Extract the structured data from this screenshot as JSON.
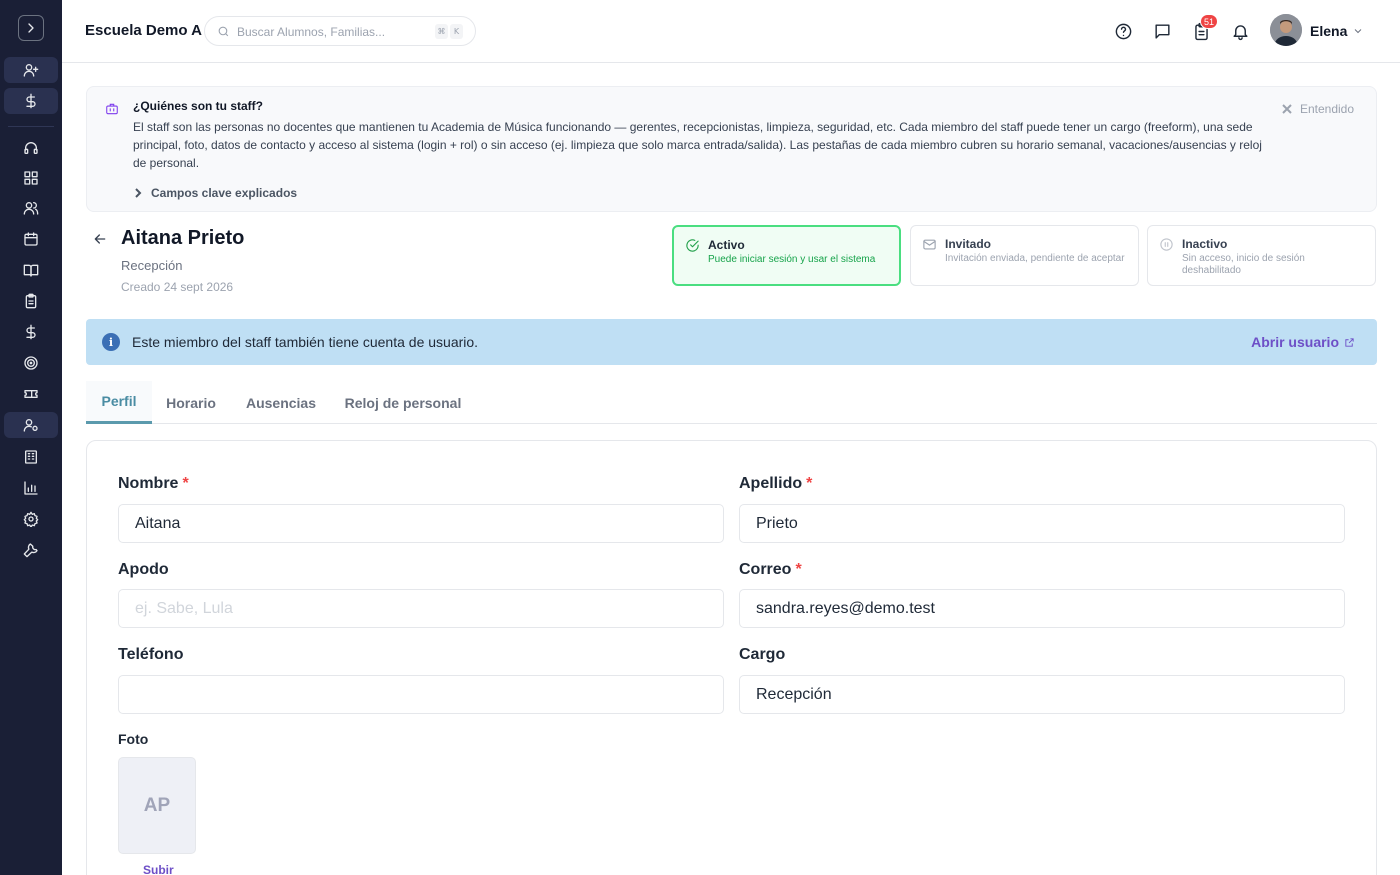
{
  "sidebar": {
    "items": [
      {
        "name": "add-user-icon"
      },
      {
        "name": "dollar-icon"
      },
      {
        "name": "headset-icon"
      },
      {
        "name": "grid-icon"
      },
      {
        "name": "users-icon"
      },
      {
        "name": "calendar-icon"
      },
      {
        "name": "book-icon"
      },
      {
        "name": "clipboard-icon"
      },
      {
        "name": "dollar-icon"
      },
      {
        "name": "target-icon"
      },
      {
        "name": "ticket-icon"
      },
      {
        "name": "user-gear-icon"
      },
      {
        "name": "building-icon"
      },
      {
        "name": "bar-chart-icon"
      },
      {
        "name": "settings-icon"
      },
      {
        "name": "wrench-icon"
      }
    ]
  },
  "topbar": {
    "school": "Escuela Demo A",
    "search_placeholder": "Buscar Alumnos, Familias...",
    "kbd1": "⌘",
    "kbd2": "K",
    "badge_count": "51",
    "user_name": "Elena"
  },
  "info": {
    "title": "¿Quiénes son tu staff?",
    "body": "El staff son las personas no docentes que mantienen tu Academia de Música funcionando — gerentes, recepcionistas, limpieza, seguridad, etc. Cada miembro del staff puede tener un cargo (freeform), una sede principal, foto, datos de contacto y acceso al sistema (login + rol) o sin acceso (ej. limpieza que solo marca entrada/salida). Las pestañas de cada miembro cubren su horario semanal, vacaciones/ausencias y reloj de personal.",
    "dismiss": "Entendido",
    "more": "Campos clave explicados"
  },
  "person": {
    "name": "Aitana Prieto",
    "role": "Recepción",
    "created": "Creado 24 sept 2026"
  },
  "statuses": [
    {
      "title": "Activo",
      "desc": "Puede iniciar sesión y usar el sistema"
    },
    {
      "title": "Invitado",
      "desc": "Invitación enviada, pendiente de aceptar"
    },
    {
      "title": "Inactivo",
      "desc": "Sin acceso, inicio de sesión deshabilitado"
    }
  ],
  "banner": {
    "icon": "i",
    "text": "Este miembro del staff también tiene cuenta de usuario.",
    "link": "Abrir usuario"
  },
  "tabs": [
    "Perfil",
    "Horario",
    "Ausencias",
    "Reloj de personal"
  ],
  "form": {
    "nombre": {
      "label": "Nombre",
      "value": "Aitana"
    },
    "apellido": {
      "label": "Apellido",
      "value": "Prieto"
    },
    "apodo": {
      "label": "Apodo",
      "value": "",
      "placeholder": "ej. Sabe, Lula"
    },
    "correo": {
      "label": "Correo",
      "value": "sandra.reyes@demo.test"
    },
    "telefono": {
      "label": "Teléfono",
      "value": ""
    },
    "cargo": {
      "label": "Cargo",
      "value": "Recepción"
    },
    "required_mark": "*",
    "photo_label": "Foto",
    "photo_initials": "AP",
    "photo_upload": "Subir"
  },
  "colors": {
    "sidebar_bg": "#1a1f36",
    "accent_teal": "#4a8ca3",
    "accent_purple": "#6d4fc7",
    "active_green": "#4ade80",
    "banner_bg": "#bfdff4",
    "badge_red": "#ef4444"
  }
}
